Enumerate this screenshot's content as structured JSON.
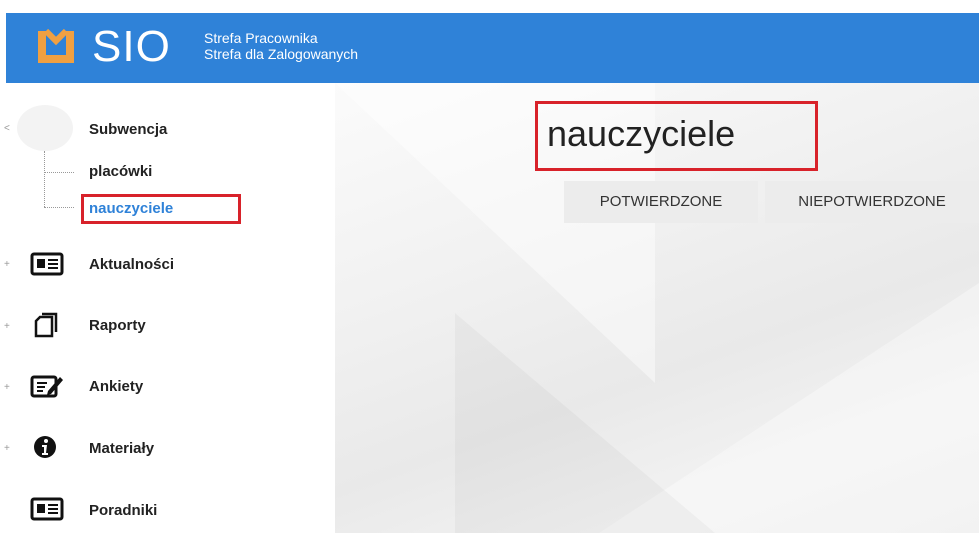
{
  "header": {
    "logo_text": "SIO",
    "subtitle_1": "Strefa Pracownika",
    "subtitle_2": "Strefa dla Zalogowanych",
    "brand_color": "#2f82d8",
    "logo_accent": "#f0a042"
  },
  "sidebar": {
    "subwencja": {
      "label": "Subwencja",
      "children": [
        {
          "label": "placówki"
        },
        {
          "label": "nauczyciele",
          "active": true
        }
      ]
    },
    "items": [
      {
        "label": "Aktualności",
        "icon": "newspaper-icon"
      },
      {
        "label": "Raporty",
        "icon": "document-icon"
      },
      {
        "label": "Ankiety",
        "icon": "edit-icon"
      },
      {
        "label": "Materiały",
        "icon": "info-icon"
      },
      {
        "label": "Poradniki",
        "icon": "newspaper-icon"
      }
    ],
    "expander_symbol": "+",
    "collapse_symbol": "<"
  },
  "main": {
    "title": "nauczyciele",
    "tabs": [
      {
        "label": "POTWIERDZONE"
      },
      {
        "label": "NIEPOTWIERDZONE"
      }
    ]
  },
  "annotation_color": "#d8222a"
}
